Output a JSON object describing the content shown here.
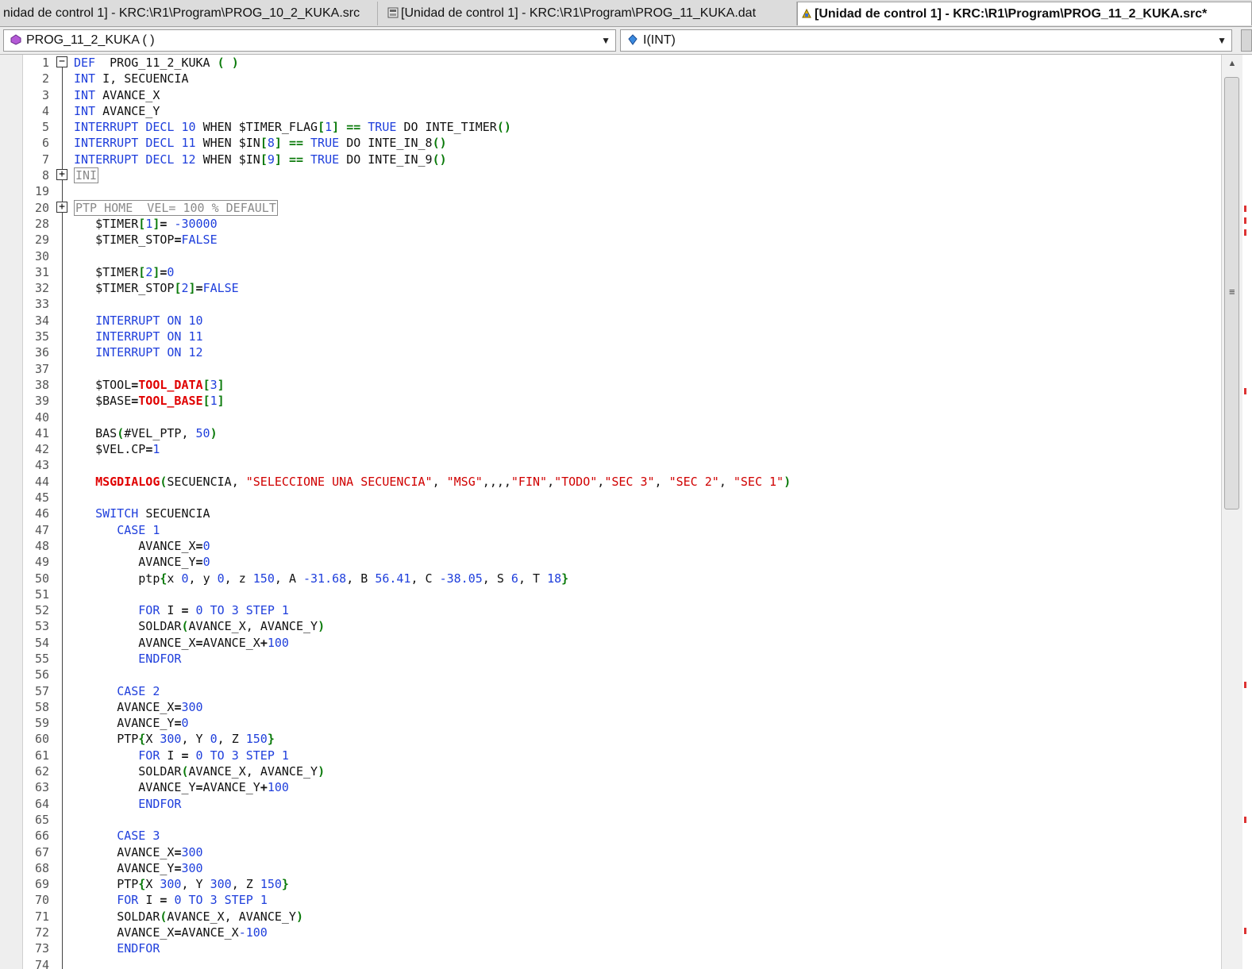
{
  "tabs": [
    {
      "label": "nidad de control 1] - KRC:\\R1\\Program\\PROG_10_2_KUKA.src",
      "active": false,
      "icon": ""
    },
    {
      "label": "[Unidad de control 1] - KRC:\\R1\\Program\\PROG_11_KUKA.dat",
      "active": false,
      "icon": "dat-file-icon"
    },
    {
      "label": "[Unidad de control 1] - KRC:\\R1\\Program\\PROG_11_2_KUKA.src*",
      "active": true,
      "icon": "src-file-icon"
    }
  ],
  "dropdowns": {
    "procedure": "PROG_11_2_KUKA ( )",
    "variable": "I(INT)"
  },
  "colors": {
    "keyword": "#1f3fdc",
    "number": "#1f3fdc",
    "operator": "#0a7a0a",
    "red_identifier": "#e00000",
    "string": "#d00000",
    "plain": "#111111",
    "folded": "#8a8a8a"
  },
  "code_lines": [
    {
      "n": "1",
      "fold": "minus",
      "t": "DEF  PROG_11_2_KUKA ( )"
    },
    {
      "n": "2",
      "t": "INT I, SECUENCIA"
    },
    {
      "n": "3",
      "t": "INT AVANCE_X"
    },
    {
      "n": "4",
      "t": "INT AVANCE_Y"
    },
    {
      "n": "5",
      "t": "INTERRUPT DECL 10 WHEN $TIMER_FLAG[1] == TRUE DO INTE_TIMER()"
    },
    {
      "n": "6",
      "t": "INTERRUPT DECL 11 WHEN $IN[8] == TRUE DO INTE_IN_8()"
    },
    {
      "n": "7",
      "t": "INTERRUPT DECL 12 WHEN $IN[9] == TRUE DO INTE_IN_9()"
    },
    {
      "n": "8",
      "fold": "plus",
      "t": "INI",
      "boxed": true
    },
    {
      "n": "19",
      "t": ""
    },
    {
      "n": "20",
      "fold": "plus",
      "t": "PTP HOME  VEL= 100 % DEFAULT",
      "boxed": true
    },
    {
      "n": "28",
      "t": "   $TIMER[1]= -30000"
    },
    {
      "n": "29",
      "t": "   $TIMER_STOP=FALSE"
    },
    {
      "n": "30",
      "t": ""
    },
    {
      "n": "31",
      "t": "   $TIMER[2]=0"
    },
    {
      "n": "32",
      "t": "   $TIMER_STOP[2]=FALSE"
    },
    {
      "n": "33",
      "t": ""
    },
    {
      "n": "34",
      "t": "   INTERRUPT ON 10"
    },
    {
      "n": "35",
      "t": "   INTERRUPT ON 11"
    },
    {
      "n": "36",
      "t": "   INTERRUPT ON 12"
    },
    {
      "n": "37",
      "t": ""
    },
    {
      "n": "38",
      "t": "   $TOOL=TOOL_DATA[3]"
    },
    {
      "n": "39",
      "t": "   $BASE=TOOL_BASE[1]"
    },
    {
      "n": "40",
      "t": ""
    },
    {
      "n": "41",
      "t": "   BAS(#VEL_PTP, 50)"
    },
    {
      "n": "42",
      "t": "   $VEL.CP=1"
    },
    {
      "n": "43",
      "t": ""
    },
    {
      "n": "44",
      "t": "   MSGDIALOG(SECUENCIA, \"SELECCIONE UNA SECUENCIA\", \"MSG\",,,,\"FIN\",\"TODO\",\"SEC 3\", \"SEC 2\", \"SEC 1\")"
    },
    {
      "n": "45",
      "t": ""
    },
    {
      "n": "46",
      "t": "   SWITCH SECUENCIA"
    },
    {
      "n": "47",
      "t": "      CASE 1"
    },
    {
      "n": "48",
      "t": "         AVANCE_X=0"
    },
    {
      "n": "49",
      "t": "         AVANCE_Y=0"
    },
    {
      "n": "50",
      "t": "         ptp{x 0, y 0, z 150, A -31.68, B 56.41, C -38.05, S 6, T 18}"
    },
    {
      "n": "51",
      "t": ""
    },
    {
      "n": "52",
      "t": "         FOR I = 0 TO 3 STEP 1"
    },
    {
      "n": "53",
      "t": "         SOLDAR(AVANCE_X, AVANCE_Y)"
    },
    {
      "n": "54",
      "t": "         AVANCE_X=AVANCE_X+100"
    },
    {
      "n": "55",
      "t": "         ENDFOR"
    },
    {
      "n": "56",
      "t": ""
    },
    {
      "n": "57",
      "t": "      CASE 2"
    },
    {
      "n": "58",
      "t": "      AVANCE_X=300"
    },
    {
      "n": "59",
      "t": "      AVANCE_Y=0"
    },
    {
      "n": "60",
      "t": "      PTP{X 300, Y 0, Z 150}"
    },
    {
      "n": "61",
      "t": "         FOR I = 0 TO 3 STEP 1"
    },
    {
      "n": "62",
      "t": "         SOLDAR(AVANCE_X, AVANCE_Y)"
    },
    {
      "n": "63",
      "t": "         AVANCE_Y=AVANCE_Y+100"
    },
    {
      "n": "64",
      "t": "         ENDFOR"
    },
    {
      "n": "65",
      "t": ""
    },
    {
      "n": "66",
      "t": "      CASE 3"
    },
    {
      "n": "67",
      "t": "      AVANCE_X=300"
    },
    {
      "n": "68",
      "t": "      AVANCE_Y=300"
    },
    {
      "n": "69",
      "t": "      PTP{X 300, Y 300, Z 150}"
    },
    {
      "n": "70",
      "t": "      FOR I = 0 TO 3 STEP 1"
    },
    {
      "n": "71",
      "t": "      SOLDAR(AVANCE_X, AVANCE_Y)"
    },
    {
      "n": "72",
      "t": "      AVANCE_X=AVANCE_X-100"
    },
    {
      "n": "73",
      "t": "      ENDFOR"
    },
    {
      "n": "74",
      "t": ""
    }
  ]
}
